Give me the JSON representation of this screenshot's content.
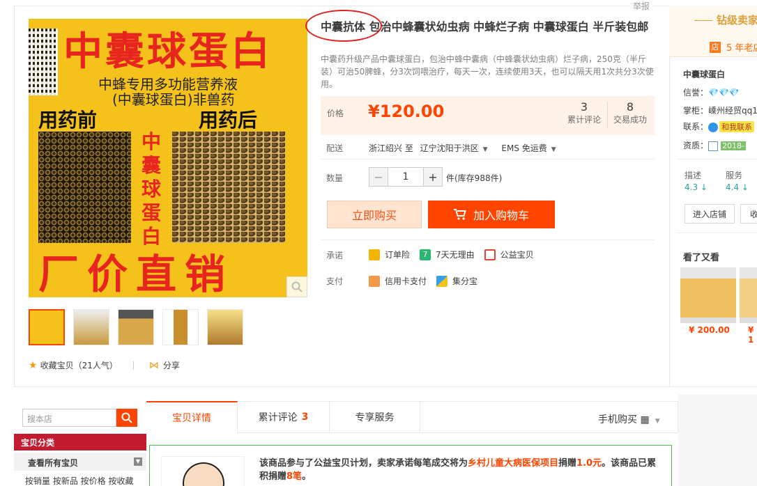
{
  "report": "举报",
  "gallery": {
    "main_image": {
      "headline": "中囊球蛋白",
      "subline1": "中蜂专用多功能营养液",
      "subline2": "(中囊球蛋白)非兽药",
      "before": "用药前",
      "after": "用药后",
      "vertical": "中囊球蛋白",
      "bottom": "厂价直销"
    },
    "thumb_count": 5
  },
  "favorite": {
    "label": "收藏宝贝（21人气）",
    "share": "分享"
  },
  "product": {
    "title_before": "中囊抗体 ",
    "title_rest": "包治中蜂囊状幼虫病 中蜂烂子病 中囊球蛋白 半斤装包邮",
    "desc": "中囊药升级产品中囊球蛋白，包治中蜂中囊病（中蜂囊状幼虫病）烂子病，250克（半斤装）可治50脾蜂，分3次饲喂治疗，每天一次，连续使用3天，也可以隔天用1次共分3次使用。",
    "price_label": "价格",
    "price": "¥120.00",
    "reviews_count": "3",
    "reviews_label": "累计评论",
    "sales_count": "8",
    "sales_label": "交易成功",
    "delivery_label": "配送",
    "delivery_from": "浙江绍兴 至",
    "delivery_to": "辽宁沈阳于洪区",
    "shipping": "EMS 免运费",
    "qty_label": "数量",
    "qty_value": "1",
    "qty_minus": "−",
    "qty_plus": "+",
    "stock": "件(库存988件)",
    "buy_now": "立即购买",
    "add_cart": "加入购物车",
    "promise_label": "承诺",
    "promises": [
      "订单险",
      "7天无理由",
      "公益宝贝"
    ],
    "pay_label": "支付",
    "payments": [
      "信用卡支付",
      "集分宝"
    ]
  },
  "shop": {
    "level": "钻级卖家",
    "years": "5 年老店",
    "years_badge": "店",
    "name": "中囊球蛋白",
    "credit_label": "信誉：",
    "credit_value": "💎💎💎",
    "owner_label": "掌柜：",
    "owner_value": "嵊州经贸qq1",
    "contact_label": "联系：",
    "contact_value": "和我联系",
    "qual_label": "资质：",
    "qual_value": "2018-",
    "dsr": [
      {
        "label": "描述",
        "value": "4.3 ↓"
      },
      {
        "label": "服务",
        "value": "4.4 ↓"
      }
    ],
    "enter_shop": "进入店铺",
    "fav_shop": "收",
    "also_viewed": "看了又看",
    "rec_prices": [
      "¥ 200.00",
      "¥ 1"
    ]
  },
  "sidebar": {
    "search_placeholder": "搜本店",
    "category_title": "宝贝分类",
    "all_items": "查看所有宝贝",
    "links": "按销量 按新品 按价格 按收藏"
  },
  "tabs": {
    "details": "宝贝详情",
    "reviews": "累计评论",
    "reviews_count": "3",
    "service": "专享服务",
    "mobile": "手机购买"
  },
  "charity": {
    "text1": "该商品参与了公益宝贝计划，卖家承诺每笔成交将为",
    "project": "乡村儿童大病医保项目",
    "text2": "捐赠",
    "amount": "1.0元",
    "text3": "。该商品已累积捐赠",
    "count": "8笔",
    "text4": "。"
  }
}
